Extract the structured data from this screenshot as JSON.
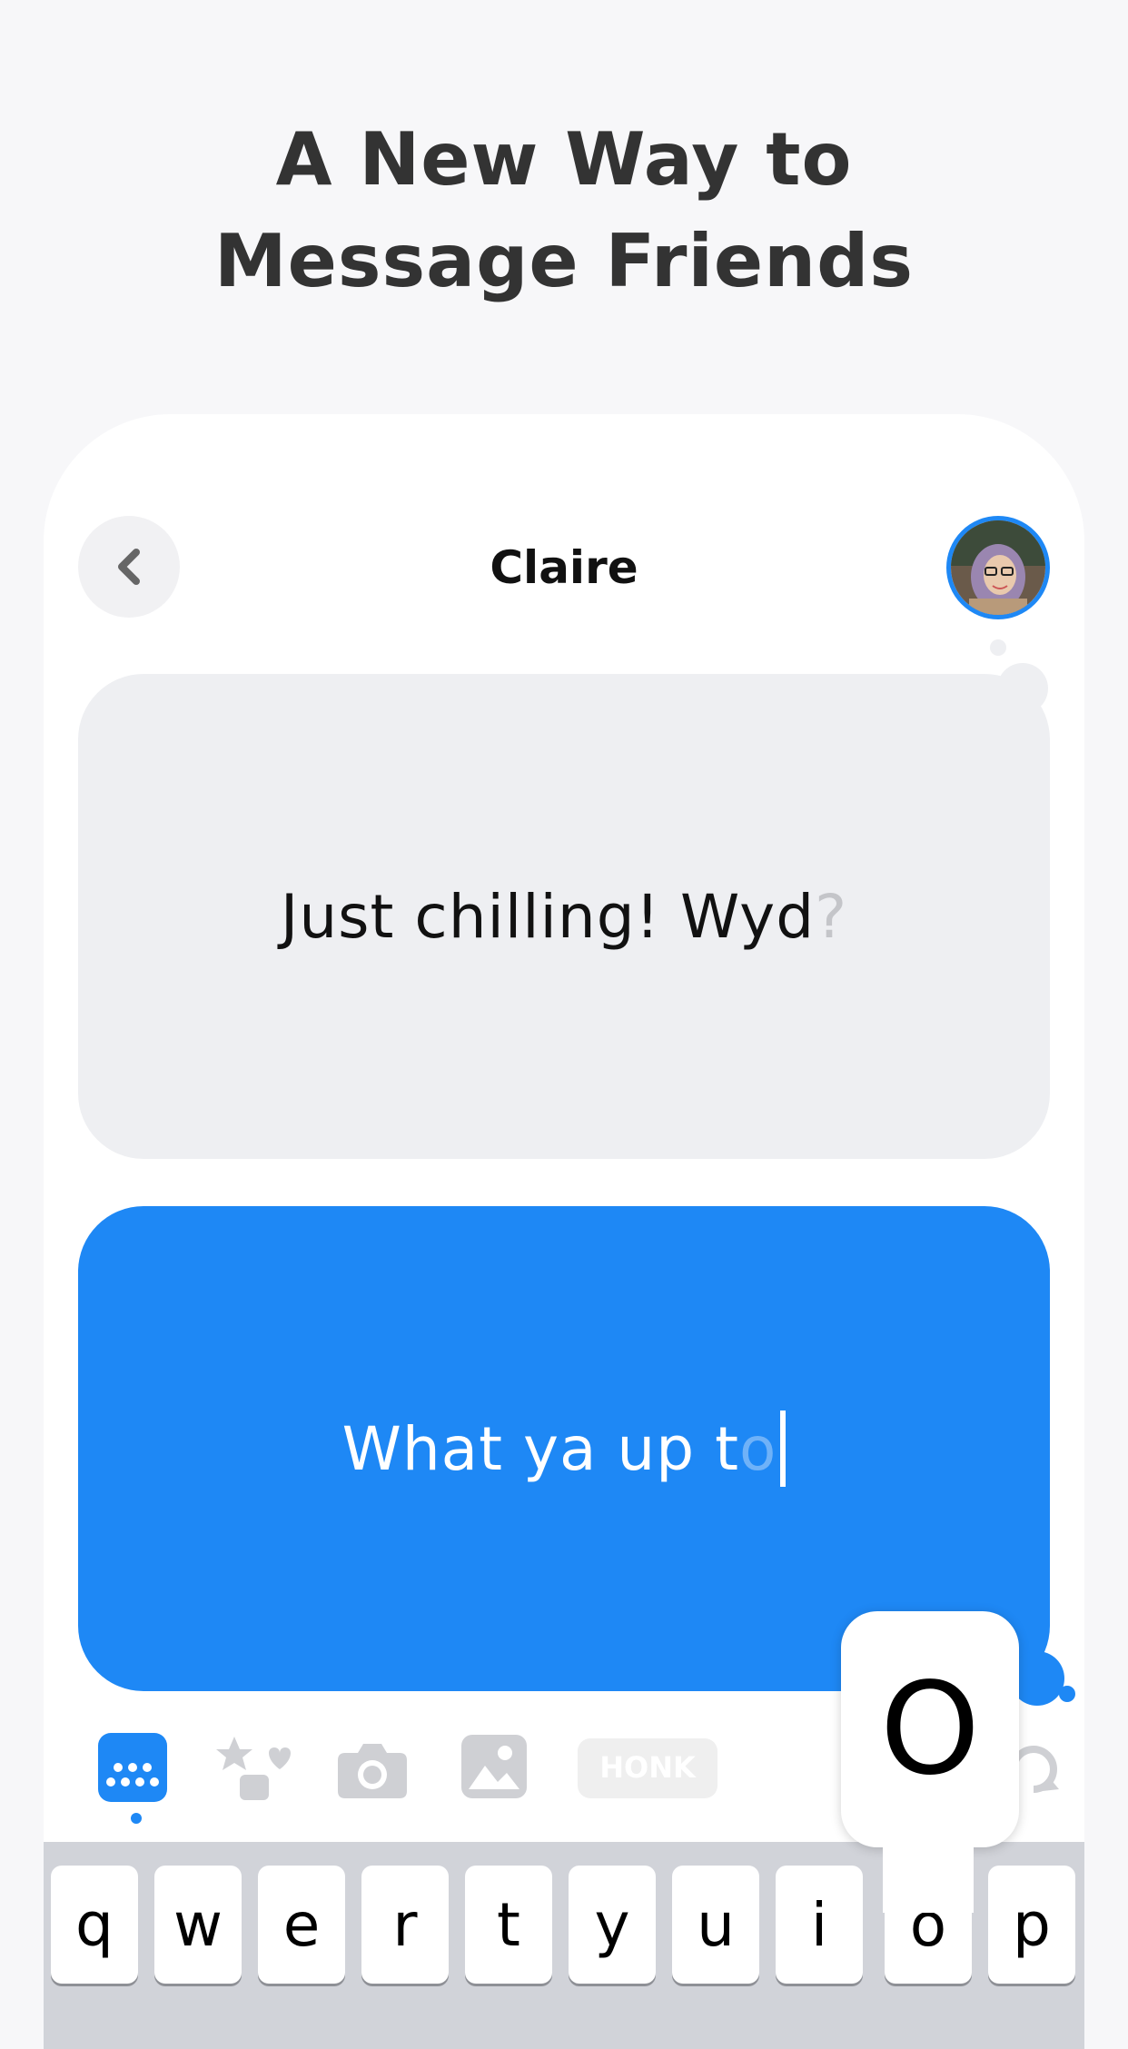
{
  "headline": {
    "line1": "A New Way to",
    "line2": "Message Friends"
  },
  "chat": {
    "contact_name": "Claire",
    "incoming_message": {
      "text": "Just chilling! Wyd",
      "faded_suffix": "?"
    },
    "outgoing_draft": {
      "text": "What ya up t",
      "ghost_suffix": "o"
    }
  },
  "toolbar": {
    "icons": [
      "keyboard-icon",
      "stickers-icon",
      "camera-icon",
      "photo-icon",
      "honk-icon"
    ],
    "honk_label": "HONK",
    "active": "keyboard-icon"
  },
  "keyboard": {
    "row1": [
      "q",
      "w",
      "e",
      "r",
      "t",
      "y",
      "u",
      "i",
      "o",
      "p"
    ],
    "popup_key": "O"
  },
  "colors": {
    "accent": "#1e88f5",
    "incoming_bubble": "#eeeff2",
    "background": "#f7f7f9"
  }
}
